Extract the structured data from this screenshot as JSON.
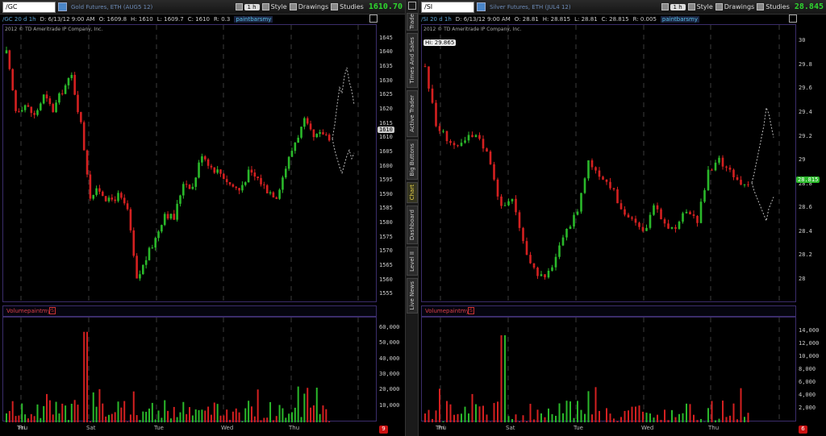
{
  "colors": {
    "up": "#2ab82a",
    "down": "#d42020",
    "grid": "#3b3b3b",
    "frame": "#3b2d6b",
    "price_up": "#2fd62f"
  },
  "sidebar": {
    "tabs": [
      "Trade",
      "Times And Sales",
      "Active Trader",
      "Big Buttons",
      "Chart",
      "Dashboard",
      "Level II",
      "Live News"
    ],
    "active": "Chart"
  },
  "left": {
    "symbol": "/GC",
    "description": "Gold Futures, ETH (AUG5 12)",
    "period": "1 h",
    "buttons": {
      "style": "Style",
      "drawings": "Drawings",
      "studies": "Studies"
    },
    "last_price": "1610.70",
    "info": {
      "title": "/GC 20 d 1h",
      "date": "D: 6/13/12 9:00 AM",
      "open": "O: 1609.8",
      "high": "H: 1610",
      "low": "L: 1609.7",
      "close": "C: 1610",
      "range": "R: 0.3",
      "study": "paintbarsmy"
    },
    "copyright": "2012 © TD Ameritrade IP Company, Inc.",
    "y_ticks": [
      "1645",
      "1640",
      "1635",
      "1630",
      "1625",
      "1620",
      "1615",
      "1610",
      "1605",
      "1600",
      "1595",
      "1590",
      "1585",
      "1580",
      "1575",
      "1570",
      "1565",
      "1560",
      "1555"
    ],
    "y_range": [
      1554,
      1646
    ],
    "price_tag": "1610",
    "volume_title": "Volumepaintmy",
    "volume_ticks": [
      "60,000",
      "50,000",
      "40,000",
      "30,000",
      "20,000",
      "10,000"
    ],
    "volume_max": 62000,
    "badge": "9",
    "x_labels": [
      "Thu",
      "Fri",
      "Sat",
      "Tue",
      "Wed",
      "Thu"
    ]
  },
  "right": {
    "symbol": "/SI",
    "description": "Silver Futures, ETH (JUL4 12)",
    "period": "1 h",
    "buttons": {
      "style": "Style",
      "drawings": "Drawings",
      "studies": "Studies"
    },
    "last_price": "28.845",
    "info": {
      "title": "/SI 20 d 1h",
      "date": "D: 6/13/12 9:00 AM",
      "open": "O: 28.81",
      "high": "H: 28.815",
      "low": "L: 28.81",
      "close": "C: 28.815",
      "range": "R: 0.005",
      "study": "paintbarsmy"
    },
    "copyright": "2012 © TD Ameritrade IP Company, Inc.",
    "hi_label": "Hi: 29.865",
    "y_ticks": [
      "30",
      "29.8",
      "29.6",
      "29.4",
      "29.2",
      "29",
      "28.8",
      "28.6",
      "28.4",
      "28.2",
      "28"
    ],
    "y_range": [
      27.85,
      30.05
    ],
    "price_tag": "28.815",
    "volume_title": "Volumepaintmy",
    "volume_ticks": [
      "14,000",
      "12,000",
      "10,000",
      "8,000",
      "6,000",
      "4,000",
      "2,000"
    ],
    "volume_max": 15000,
    "badge": "6",
    "x_labels": [
      "Thu",
      "Fri",
      "Sat",
      "Tue",
      "Wed",
      "Thu"
    ]
  },
  "chart_data": [
    {
      "type": "candlestick",
      "title": "/GC 20 d 1h",
      "ylim": [
        1554,
        1646
      ],
      "path": [
        1640,
        1620,
        1622,
        1618,
        1625,
        1620,
        1627,
        1632,
        1615,
        1590,
        1592,
        1588,
        1590,
        1585,
        1560,
        1568,
        1575,
        1584,
        1582,
        1595,
        1593,
        1605,
        1600,
        1598,
        1594,
        1592,
        1598,
        1596,
        1592,
        1590,
        1600,
        1609,
        1616,
        1610,
        1612,
        1610
      ],
      "segments": [
        "Thu",
        "Fri",
        "Sat",
        "Tue",
        "Wed"
      ],
      "volume_peak": 58000
    },
    {
      "type": "candlestick",
      "title": "/SI 20 d 1h",
      "ylim": [
        27.85,
        30.05
      ],
      "path": [
        29.8,
        29.3,
        29.2,
        29.1,
        29.2,
        29.2,
        29.0,
        28.6,
        28.7,
        28.3,
        28.1,
        28.0,
        28.2,
        28.4,
        28.6,
        29.0,
        28.9,
        28.8,
        28.6,
        28.5,
        28.4,
        28.6,
        28.5,
        28.4,
        28.6,
        28.5,
        28.9,
        29.0,
        28.9,
        28.8,
        28.82
      ],
      "segments": [
        "Thu",
        "Fri",
        "Sat",
        "Tue",
        "Wed"
      ],
      "volume_peak": 13500
    }
  ]
}
